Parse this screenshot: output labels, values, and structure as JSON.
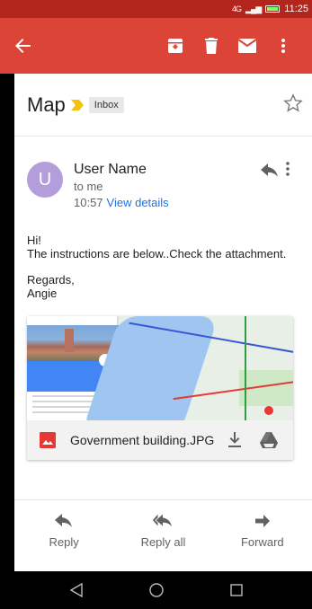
{
  "status_bar": {
    "signal": "4G",
    "time": "11:25"
  },
  "email": {
    "subject": "Map",
    "label": "Inbox",
    "sender": {
      "avatar_letter": "U",
      "name": "User Name",
      "to": "to me",
      "time": "10:57",
      "view_details": "View details"
    },
    "body": {
      "greeting": "Hi!",
      "line": "The instructions are below..Check the attachment.",
      "closing": "Regards,",
      "signature": "Angie"
    },
    "attachment": {
      "file_name": "Government building.JPG"
    }
  },
  "reply_bar": {
    "reply": "Reply",
    "reply_all": "Reply all",
    "forward": "Forward"
  },
  "colors": {
    "app_bar": "#db4437",
    "status_bar": "#b3261e",
    "avatar": "#b39ddb",
    "link": "#1a73e8"
  },
  "icons": [
    "back-arrow-icon",
    "archive-icon",
    "delete-icon",
    "mail-icon",
    "more-vert-icon",
    "importance-icon",
    "star-icon",
    "reply-icon",
    "reply-all-icon",
    "forward-icon",
    "image-icon",
    "download-icon",
    "drive-icon",
    "nav-back-icon",
    "nav-home-icon",
    "nav-recents-icon"
  ]
}
